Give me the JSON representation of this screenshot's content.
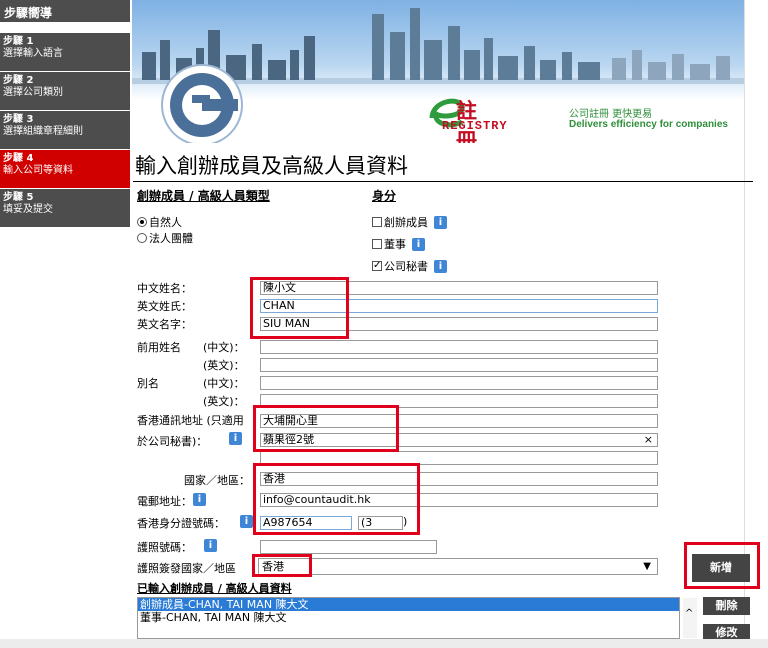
{
  "sidebar": {
    "header": "步驟嚮導",
    "steps": [
      {
        "num": "步驟 1",
        "label": "選擇輸入語言"
      },
      {
        "num": "步驟 2",
        "label": "選擇公司類別"
      },
      {
        "num": "步驟 3",
        "label": "選擇組織章程細則"
      },
      {
        "num": "步驟 4",
        "label": "輸入公司等資料",
        "active": true
      },
      {
        "num": "步驟 5",
        "label": "填妥及提交"
      }
    ]
  },
  "banner": {
    "brand_cn": "註冊易",
    "brand_en": "REGISTRY",
    "slogan_cn": "公司註冊 更快更易",
    "slogan_en": "Delivers efficiency for companies"
  },
  "page_title": "輸入創辦成員及高級人員資料",
  "form": {
    "type_title": "創辦成員 / 高級人員類型",
    "type_options": [
      "自然人",
      "法人團體"
    ],
    "role_title": "身分",
    "roles": [
      {
        "label": "創辦成員",
        "checked": false
      },
      {
        "label": "董事",
        "checked": false
      },
      {
        "label": "公司秘書",
        "checked": true
      }
    ],
    "labels": {
      "chinese_name": "中文姓名：",
      "english_surname": "英文姓氏：",
      "english_given": "英文名字：",
      "former_name": "前用姓名",
      "alias": "別名",
      "cn": "(中文)：",
      "en": "(英文)：",
      "address_1": "香港通訊地址 (只適用",
      "address_2": "於公司秘書)：",
      "country": "國家／地區：",
      "email": "電郵地址：",
      "hkid": "香港身分證號碼：",
      "passport": "護照號碼：",
      "passport_country": "護照簽發國家／地區"
    },
    "values": {
      "chinese_name": "陳小文",
      "english_surname": "CHAN",
      "english_given": "SIU MAN",
      "address_line1": "大埔開心里",
      "address_line2": "蘋果徑2號",
      "country": "香港",
      "email": "info@countaudit.hk",
      "hkid": "A987654",
      "hkid_check": "(3",
      "hkid_close": ")",
      "passport_country": "香港"
    },
    "add_button": "新增",
    "entered_title": "已輸入創辦成員 / 高級人員資料",
    "entered": [
      "創辦成員-CHAN, TAI MAN 陳大文",
      "董事-CHAN, TAI MAN 陳大文"
    ],
    "delete_button": "刪除",
    "edit_button": "修改"
  },
  "colors": {
    "accent_red": "#e0001b",
    "sidebar_active": "#d00000",
    "info_blue": "#3f86d6",
    "brand_red": "#c30d23"
  },
  "icons": [
    "info-icon",
    "chevron-down-icon",
    "clear-icon"
  ]
}
